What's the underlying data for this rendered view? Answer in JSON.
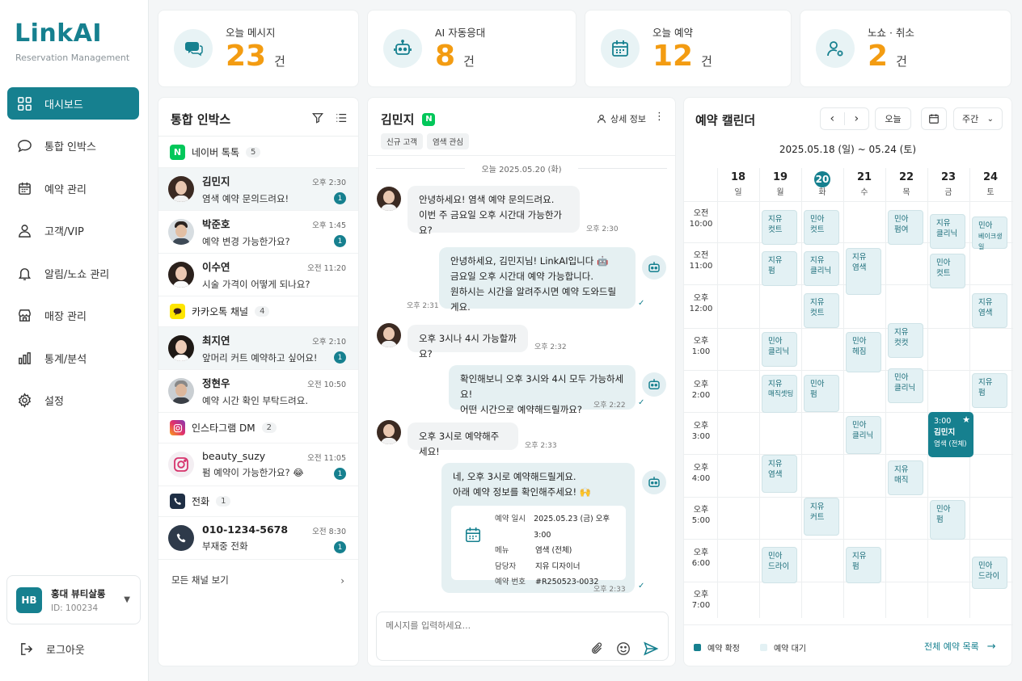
{
  "app": {
    "logo": "LinkAI",
    "subtitle": "Reservation Management"
  },
  "sidebar": {
    "items": [
      {
        "label": "대시보드",
        "icon": "dashboard-icon"
      },
      {
        "label": "통합 인박스",
        "icon": "chat-bubble-icon"
      },
      {
        "label": "예약 관리",
        "icon": "calendar-icon"
      },
      {
        "label": "고객/VIP",
        "icon": "user-icon"
      },
      {
        "label": "알림/노쇼 관리",
        "icon": "bell-icon"
      },
      {
        "label": "매장 관리",
        "icon": "store-icon"
      },
      {
        "label": "통계/분석",
        "icon": "bar-chart-icon"
      },
      {
        "label": "설정",
        "icon": "gear-icon"
      }
    ],
    "account": {
      "initials": "HB",
      "name": "홍대 뷰티살롱",
      "id": "ID: 100234"
    },
    "logout": "로그아웃"
  },
  "stats": [
    {
      "label": "오늘 메시지",
      "value": "23",
      "unit": "건"
    },
    {
      "label": "AI 자동응대",
      "value": "8",
      "unit": "건"
    },
    {
      "label": "오늘 예약",
      "value": "12",
      "unit": "건"
    },
    {
      "label": "노쇼 · 취소",
      "value": "2",
      "unit": "건"
    }
  ],
  "inbox": {
    "title": "통합 인박스",
    "channels": {
      "naver": {
        "name": "네이버 톡톡",
        "count": "5",
        "badge": "N",
        "color": "#03c75a"
      },
      "kakao": {
        "name": "카카오톡 채널",
        "count": "4"
      },
      "insta": {
        "name": "인스타그램 DM",
        "count": "2"
      },
      "phone": {
        "name": "전화",
        "count": "1"
      }
    },
    "conversations": [
      {
        "name": "김민지",
        "preview": "염색 예약 문의드려요!",
        "time": "오후 2:30",
        "unread": "1"
      },
      {
        "name": "박준호",
        "preview": "예약 변경 가능한가요?",
        "time": "오후 1:45",
        "unread": "1"
      },
      {
        "name": "이수연",
        "preview": "시술 가격이 어떻게 되나요?",
        "time": "오전 11:20"
      },
      {
        "name": "최지연",
        "preview": "앞머리 커트 예약하고 싶어요!",
        "time": "오후 2:10",
        "unread": "1"
      },
      {
        "name": "정현우",
        "preview": "예약 시간 확인 부탁드려요.",
        "time": "오전 10:50"
      },
      {
        "name": "beauty_suzy",
        "preview": "펌 예약이 가능한가요? 😂",
        "time": "오전 11:05",
        "unread": "1"
      },
      {
        "name": "010-1234-5678",
        "preview": "부재중 전화",
        "time": "오전 8:30",
        "unread": "1"
      }
    ],
    "all_channels": "모든 채널 보기"
  },
  "chat": {
    "name": "김민지",
    "badge": "N",
    "detail": "상세 정보",
    "tags": [
      "신규 고객",
      "염색 관심"
    ],
    "date": "오늘 2025.05.20 (화)",
    "messages": [
      {
        "l1": "안녕하세요! 염색 예약 문의드려요.",
        "l2": "이번 주 금요일 오후 시간대 가능한가요?",
        "time": "오후 2:30"
      },
      {
        "l1": "안녕하세요, 김민지님! LinkAI입니다 🤖",
        "l2": "금요일 오후 시간대 예약 가능합니다.",
        "l3": "원하시는 시간을 알려주시면 예약 도와드릴게요.",
        "time": "오후 2:31"
      },
      {
        "l1": "오후 3시나 4시 가능할까요?",
        "time": "오후 2:32"
      },
      {
        "l1": "확인해보니 오후 3시와 4시 모두 가능하세요!",
        "l2": "어떤 시간으로 예약해드릴까요?",
        "time": "오후 2:22"
      },
      {
        "l1": "오후 3시로 예약해주세요!",
        "time": "오후 2:33"
      },
      {
        "l1": "네, 오후 3시로 예약해드릴게요.",
        "l2": "아래 예약 정보를 확인해주세요! 🙌",
        "time": "오후 2:33"
      }
    ],
    "reservation": {
      "k1": "예약 일시",
      "v1": "2025.05.23 (금) 오후 3:00",
      "k2": "메뉴",
      "v2": "염색 (전체)",
      "k3": "담당자",
      "v3": "지유 디자이너",
      "k4": "예약 번호",
      "v4": "#R250523-0032"
    },
    "placeholder": "메시지를 입력하세요..."
  },
  "calendar": {
    "title": "예약 캘린더",
    "today_btn": "오늘",
    "view": "주간",
    "range": "2025.05.18 (일) ~ 05.24 (토)",
    "days": [
      {
        "num": "18",
        "wk": "일"
      },
      {
        "num": "19",
        "wk": "월"
      },
      {
        "num": "20",
        "wk": "화"
      },
      {
        "num": "21",
        "wk": "수"
      },
      {
        "num": "22",
        "wk": "목"
      },
      {
        "num": "23",
        "wk": "금"
      },
      {
        "num": "24",
        "wk": "토"
      }
    ],
    "times": [
      {
        "a": "오전",
        "b": "10:00"
      },
      {
        "a": "오전",
        "b": "11:00"
      },
      {
        "a": "오후",
        "b": "12:00"
      },
      {
        "a": "오후",
        "b": "1:00"
      },
      {
        "a": "오후",
        "b": "2:00"
      },
      {
        "a": "오후",
        "b": "3:00"
      },
      {
        "a": "오후",
        "b": "4:00"
      },
      {
        "a": "오후",
        "b": "5:00"
      },
      {
        "a": "오후",
        "b": "6:00"
      },
      {
        "a": "오후",
        "b": "7:00"
      }
    ],
    "events": [
      {
        "a": "지유",
        "b": "컷트"
      },
      {
        "a": "민아",
        "b": "컷트"
      },
      {
        "a": "민아",
        "b": "펌여"
      },
      {
        "a": "지유",
        "b": "클리닉"
      },
      {
        "a": "민아",
        "b": "베이크생일"
      },
      {
        "a": "지유",
        "b": "펌"
      },
      {
        "a": "지유",
        "b": "클리닉"
      },
      {
        "a": "지유",
        "b": "염색"
      },
      {
        "a": "민아",
        "b": "컷트"
      },
      {
        "a": "지유",
        "b": "컷트"
      },
      {
        "a": "지유",
        "b": "염색"
      },
      {
        "a": "민아",
        "b": "클리닉"
      },
      {
        "a": "민아",
        "b": "헤짐"
      },
      {
        "a": "지유",
        "b": "컷컷"
      },
      {
        "a": "지유",
        "b": "매직셋팅"
      },
      {
        "a": "민아",
        "b": "펌"
      },
      {
        "a": "민아",
        "b": "클리닉"
      },
      {
        "a": "지유",
        "b": "펌"
      },
      {
        "a": "민아",
        "b": "클리닉"
      },
      {
        "a": "지유",
        "b": "염색"
      },
      {
        "a": "지유",
        "b": "매직"
      },
      {
        "a": "지유",
        "b": "커트"
      },
      {
        "a": "민아",
        "b": "펌"
      },
      {
        "a": "민아",
        "b": "드라이"
      },
      {
        "a": "지유",
        "b": "펌"
      },
      {
        "a": "민아",
        "b": "드라이"
      }
    ],
    "highlight": {
      "time": "3:00",
      "name": "김민지",
      "service": "염색 (전체)"
    },
    "legend": {
      "confirmed": "예약 확정",
      "pending": "예약 대기"
    },
    "all_list": "전체 예약 목록",
    "colors": {
      "accent": "#16808f",
      "number": "#f39c12"
    }
  }
}
